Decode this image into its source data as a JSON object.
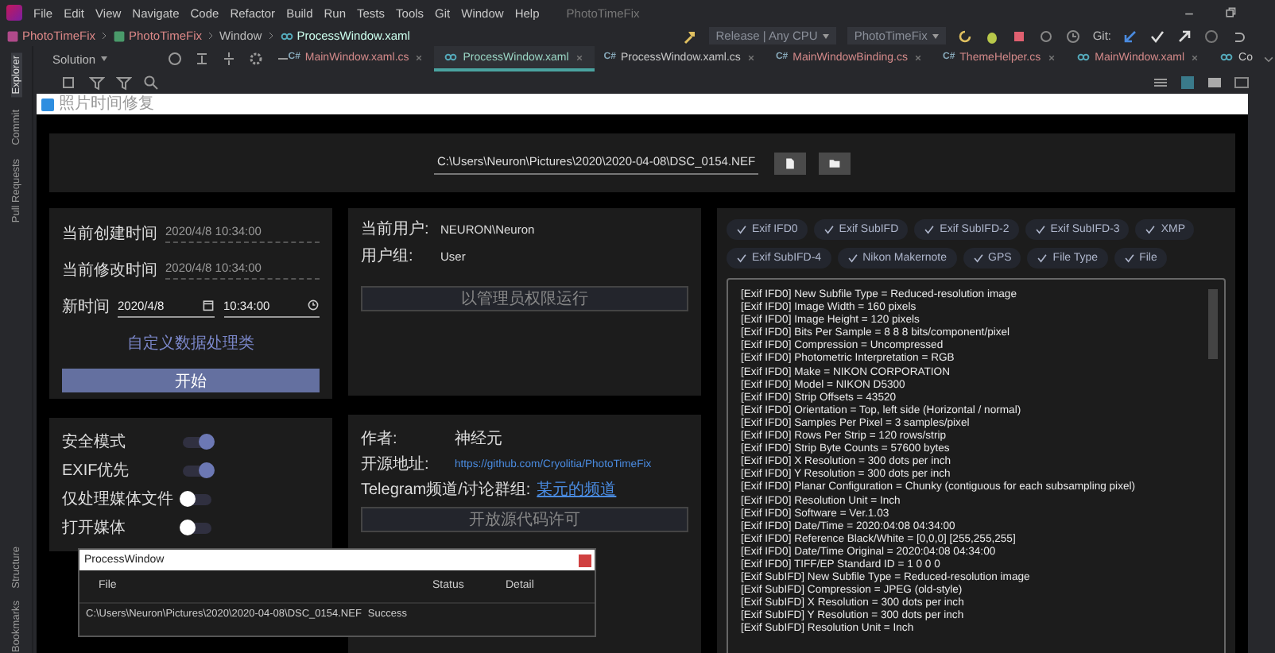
{
  "ide": {
    "menu": [
      "File",
      "Edit",
      "View",
      "Navigate",
      "Code",
      "Refactor",
      "Build",
      "Run",
      "Tests",
      "Tools",
      "Git",
      "Window",
      "Help"
    ],
    "project_title": "PhotoTimeFix",
    "breadcrumbs": [
      {
        "kind": "solution",
        "label": "PhotoTimeFix"
      },
      {
        "kind": "project",
        "label": "PhotoTimeFix"
      },
      {
        "kind": "folder",
        "label": "Window"
      },
      {
        "kind": "xaml",
        "label": "ProcessWindow.xaml"
      }
    ],
    "toolbar": {
      "configuration": "Release | Any CPU",
      "run_target": "PhotoTimeFix",
      "git_label": "Git:"
    },
    "side_tabs": [
      {
        "label": "Explorer",
        "selected": true
      },
      {
        "label": "Commit",
        "selected": false
      },
      {
        "label": "Pull Requests",
        "selected": false
      },
      {
        "label": "Structure",
        "selected": false
      },
      {
        "label": "Bookmarks",
        "selected": false
      }
    ],
    "solution_label": "Solution",
    "editor_tabs": [
      {
        "kind": "cs",
        "prefix": "C#",
        "label": "MainWindow.xaml.cs",
        "color": "#d48a8a",
        "selected": false,
        "closable": true
      },
      {
        "kind": "xaml",
        "label": "ProcessWindow.xaml",
        "color": "#9ad6c4",
        "selected": true,
        "closable": true
      },
      {
        "kind": "cs",
        "prefix": "C#",
        "label": "ProcessWindow.xaml.cs",
        "color": "#c8c8c8",
        "selected": false,
        "closable": true
      },
      {
        "kind": "cs",
        "prefix": "C#",
        "label": "MainWindowBinding.cs",
        "color": "#d48a8a",
        "selected": false,
        "closable": true
      },
      {
        "kind": "cs",
        "prefix": "C#",
        "label": "ThemeHelper.cs",
        "color": "#d48a8a",
        "selected": false,
        "closable": true
      },
      {
        "kind": "xaml",
        "label": "MainWindow.xaml",
        "color": "#d48a8a",
        "selected": false,
        "closable": true
      },
      {
        "kind": "xaml",
        "label": "Co",
        "color": "#c8c8c8",
        "selected": false,
        "closable": false
      }
    ]
  },
  "app": {
    "title": "照片时间修复",
    "path": "C:\\Users\\Neuron\\Pictures\\2020\\2020-04-08\\DSC_0154.NEF",
    "times": [
      {
        "label": "当前创建时间",
        "value": "2020/4/8 10:34:00"
      },
      {
        "label": "当前修改时间",
        "value": "2020/4/8 10:34:00"
      }
    ],
    "new_time": {
      "label": "新时间",
      "date": "2020/4/8",
      "time": "10:34:00"
    },
    "custom_link": "自定义数据处理类",
    "start_button": "开始",
    "toggles": [
      {
        "label": "安全模式",
        "on": true
      },
      {
        "label": "EXIF优先",
        "on": true
      },
      {
        "label": "仅处理媒体文件",
        "on": false
      },
      {
        "label": "打开媒体",
        "on": false
      }
    ],
    "user": {
      "rows": [
        {
          "label": "当前用户:",
          "value": "NEURON\\Neuron"
        },
        {
          "label": "用户组:",
          "value": "User"
        }
      ],
      "admin_button": "以管理员权限运行"
    },
    "about": {
      "rows": [
        {
          "kind": "text",
          "label": "作者:",
          "value": "神经元"
        },
        {
          "kind": "link",
          "label": "开源地址:",
          "value": "https://github.com/Cryolitia/PhotoTimeFix"
        },
        {
          "kind": "link",
          "label": "Telegram频道/讨论群组:",
          "value": "某元的频道"
        }
      ],
      "license_button": "开放源代码许可"
    },
    "exif_groups": [
      {
        "label": "Exif IFD0",
        "checked": true
      },
      {
        "label": "Exif SubIFD",
        "checked": true
      },
      {
        "label": "Exif SubIFD-2",
        "checked": true
      },
      {
        "label": "Exif SubIFD-3",
        "checked": true
      },
      {
        "label": "XMP",
        "checked": true
      },
      {
        "label": "Exif SubIFD-4",
        "checked": true
      },
      {
        "label": "Nikon Makernote",
        "checked": true
      },
      {
        "label": "GPS",
        "checked": true
      },
      {
        "label": "File Type",
        "checked": true
      },
      {
        "label": "File",
        "checked": true
      }
    ],
    "exif_lines": [
      "[Exif IFD0] New Subfile Type = Reduced-resolution image",
      "[Exif IFD0] Image Width = 160 pixels",
      "[Exif IFD0] Image Height = 120 pixels",
      "[Exif IFD0] Bits Per Sample = 8 8 8 bits/component/pixel",
      "[Exif IFD0] Compression = Uncompressed",
      "[Exif IFD0] Photometric Interpretation = RGB",
      "[Exif IFD0] Make = NIKON CORPORATION",
      "[Exif IFD0] Model = NIKON D5300",
      "[Exif IFD0] Strip Offsets = 43520",
      "[Exif IFD0] Orientation = Top, left side (Horizontal / normal)",
      "[Exif IFD0] Samples Per Pixel = 3 samples/pixel",
      "[Exif IFD0] Rows Per Strip = 120 rows/strip",
      "[Exif IFD0] Strip Byte Counts = 57600 bytes",
      "[Exif IFD0] X Resolution = 300 dots per inch",
      "[Exif IFD0] Y Resolution = 300 dots per inch",
      "[Exif IFD0] Planar Configuration = Chunky (contiguous for each subsampling pixel)",
      "[Exif IFD0] Resolution Unit = Inch",
      "[Exif IFD0] Software = Ver.1.03",
      "[Exif IFD0] Date/Time = 2020:04:08 04:34:00",
      "[Exif IFD0] Reference Black/White = [0,0,0] [255,255,255]",
      "[Exif IFD0] Date/Time Original = 2020:04:08 04:34:00",
      "[Exif IFD0] TIFF/EP Standard ID = 1 0 0 0",
      "[Exif SubIFD] New Subfile Type = Reduced-resolution image",
      "[Exif SubIFD] Compression = JPEG (old-style)",
      "[Exif SubIFD] X Resolution = 300 dots per inch",
      "[Exif SubIFD] Y Resolution = 300 dots per inch",
      "[Exif SubIFD] Resolution Unit = Inch"
    ],
    "process_window": {
      "title": "ProcessWindow",
      "columns": [
        "File",
        "Status",
        "Detail"
      ],
      "rows": [
        {
          "file": "C:\\Users\\Neuron\\Pictures\\2020\\2020-04-08\\DSC_0154.NEF",
          "status": "Success"
        }
      ]
    }
  }
}
